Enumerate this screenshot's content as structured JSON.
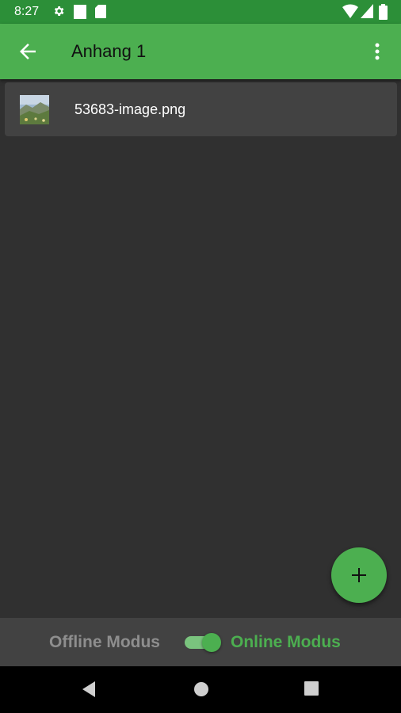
{
  "status_bar": {
    "time": "8:27",
    "left_icons": [
      "settings-icon",
      "notification-square-icon",
      "sd-card-icon"
    ],
    "right_icons": [
      "wifi-icon",
      "signal-icon",
      "battery-icon"
    ]
  },
  "app_bar": {
    "title": "Anhang 1",
    "back_icon": "arrow-back-icon",
    "menu_icon": "more-vert-icon",
    "color": "#4caf50"
  },
  "attachments": [
    {
      "filename": "53683-image.png",
      "thumbnail": "landscape-image"
    }
  ],
  "fab": {
    "icon": "plus-icon"
  },
  "mode_switch": {
    "offline_label": "Offline Modus",
    "online_label": "Online Modus",
    "state": "online",
    "accent": "#4caf50"
  },
  "nav_bar": {
    "buttons": [
      "back-triangle-icon",
      "home-circle-icon",
      "recents-square-icon"
    ]
  }
}
